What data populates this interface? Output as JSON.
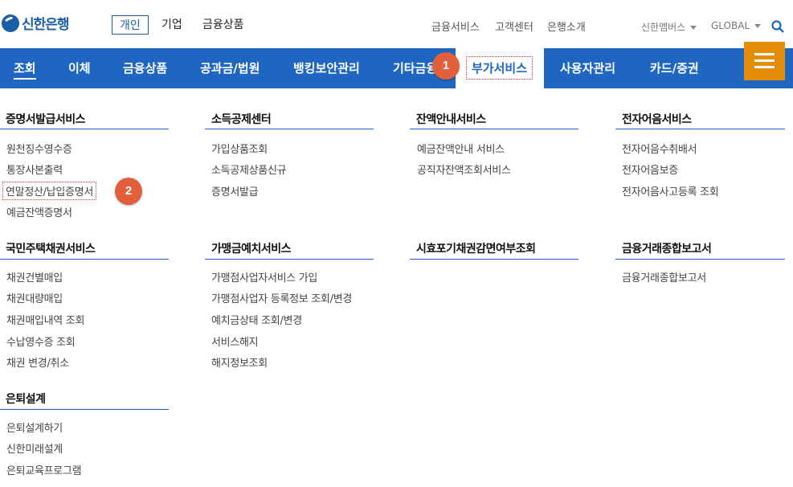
{
  "header": {
    "logo_text": "신한은행",
    "segments": [
      "개인",
      "기업",
      "금융상품"
    ],
    "util_links": [
      "금융서비스",
      "고객센터",
      "은행소개"
    ],
    "member_label": "신한멤버스",
    "global_label": "GLOBAL"
  },
  "gnb": {
    "items": [
      "조회",
      "이체",
      "금융상품",
      "공과금/법원",
      "뱅킹보안관리",
      "기타금융",
      "부가서비스",
      "사용자관리",
      "카드/증권"
    ]
  },
  "badges": [
    "1",
    "2"
  ],
  "sections": [
    {
      "title": "증명서발급서비스",
      "links": [
        "원천징수영수증",
        "통장사본출력",
        "연말정산/납입증명서",
        "예금잔액증명서"
      ]
    },
    {
      "title": "소득공제센터",
      "links": [
        "가입상품조회",
        "소득공제상품신규",
        "증명서발급"
      ]
    },
    {
      "title": "잔액안내서비스",
      "links": [
        "예금잔액안내 서비스",
        "공직자잔액조회서비스"
      ]
    },
    {
      "title": "전자어음서비스",
      "links": [
        "전자어음수취배서",
        "전자어음보증",
        "전자어음사고등록 조회"
      ]
    },
    {
      "title": "국민주택채권서비스",
      "links": [
        "채권건별매입",
        "채권대량매입",
        "채권매입내역 조회",
        "수납영수증 조회",
        "채권 변경/취소"
      ]
    },
    {
      "title": "가맹금예치서비스",
      "links": [
        "가맹점사업자서비스 가입",
        "가맹점사업자 등록정보 조회/변경",
        "예치금상태 조회/변경",
        "서비스해지",
        "해지정보조회"
      ]
    },
    {
      "title": "시효포기채권감면여부조회",
      "links": []
    },
    {
      "title": "금융거래종합보고서",
      "links": [
        "금융거래종합보고서"
      ]
    },
    {
      "title": "은퇴설계",
      "links": [
        "은퇴설계하기",
        "신한미래설계",
        "은퇴교육프로그램"
      ]
    }
  ]
}
